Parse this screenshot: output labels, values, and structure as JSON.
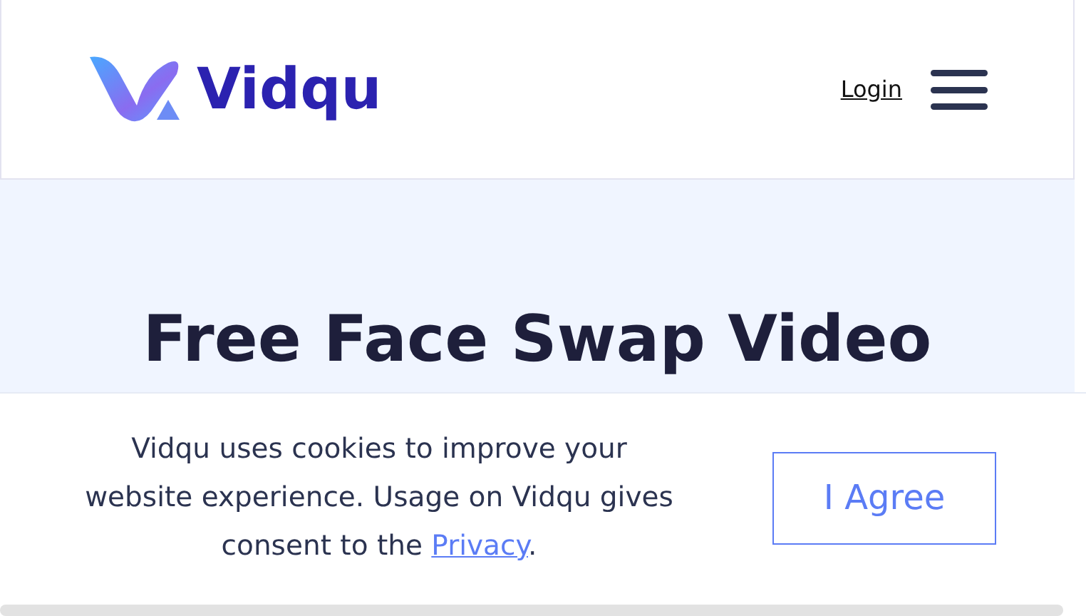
{
  "header": {
    "brand": "Vidqu",
    "login": "Login"
  },
  "hero": {
    "title": "Free Face Swap Video"
  },
  "cookie_banner": {
    "text": "Vidqu uses cookies to improve your website experience. Usage on Vidqu gives consent to the",
    "link": "Privacy",
    "after": ".",
    "button": "I Agree"
  }
}
